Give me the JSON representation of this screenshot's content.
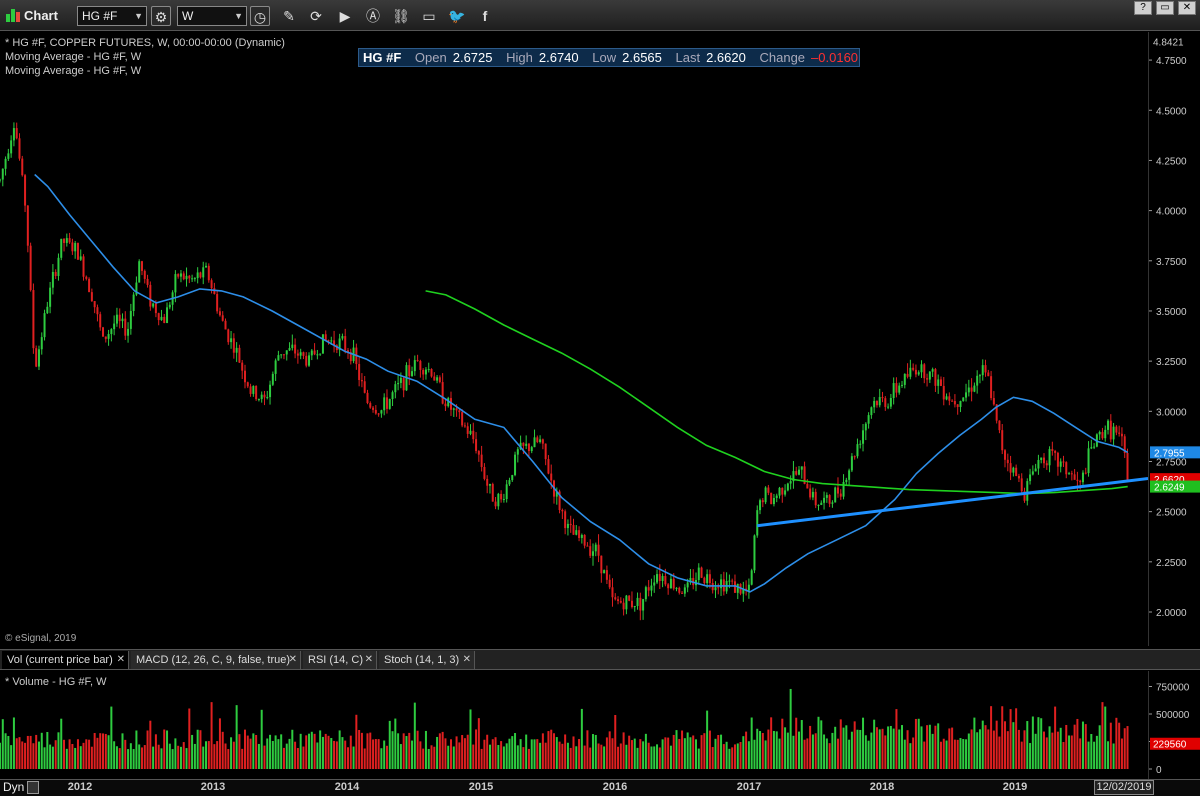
{
  "toolbar": {
    "app_title": "Chart",
    "symbol": "HG #F",
    "interval": "W",
    "help_label": "?"
  },
  "chart_header": {
    "line1": "* HG #F, COPPER FUTURES, W, 00:00-00:00 (Dynamic)",
    "line2": "Moving Average - HG #F, W",
    "line3": "Moving Average - HG #F, W"
  },
  "quote": {
    "symbol": "HG #F",
    "open_label": "Open",
    "open": "2.6725",
    "high_label": "High",
    "high": "2.6740",
    "low_label": "Low",
    "low": "2.6565",
    "last_label": "Last",
    "last": "2.6620",
    "change_label": "Change",
    "change": "–0.0160"
  },
  "copyright": "© eSignal, 2019",
  "tabs": [
    {
      "label": "Vol (current price bar)"
    },
    {
      "label": "MACD (12, 26, C, 9, false, true)"
    },
    {
      "label": "RSI (14, C)"
    },
    {
      "label": "Stoch (14, 1, 3)"
    }
  ],
  "volume_panel": {
    "title": "* Volume - HG #F, W",
    "ticks": [
      "750000",
      "500000",
      "250000",
      "0"
    ],
    "last_volume": "229560"
  },
  "time_axis": {
    "mode": "Dyn",
    "date": "12/02/2019",
    "years": [
      "2012",
      "2013",
      "2014",
      "2015",
      "2016",
      "2017",
      "2018",
      "2019"
    ]
  },
  "chart_data": {
    "type": "line",
    "title": "",
    "xlabel": "",
    "ylabel": "",
    "x_range": [
      2011.62,
      2019.55
    ],
    "ylim": [
      1.91,
      4.86
    ],
    "y_ticks": [
      "4.7500",
      "4.5000",
      "4.2500",
      "4.0000",
      "3.7500",
      "3.5000",
      "3.2500",
      "3.0000",
      "2.7500",
      "2.5000",
      "2.2500",
      "2.0000"
    ],
    "y_top_label": "4.8421",
    "price_labels": [
      {
        "text": "2.7955",
        "value": 2.7955,
        "color": "#1e88e5"
      },
      {
        "text": "2.6620",
        "value": 2.662,
        "color": "#e00000"
      },
      {
        "text": "2.6249",
        "value": 2.6249,
        "color": "#1fbf1f"
      }
    ],
    "series": [
      {
        "name": "Moving Average - HG #F, W",
        "color": "#2d8ee8",
        "x": [
          2011.86,
          2011.95,
          2012.1,
          2012.25,
          2012.4,
          2012.55,
          2012.7,
          2012.85,
          2013.0,
          2013.15,
          2013.3,
          2013.5,
          2013.7,
          2013.85,
          2014.0,
          2014.15,
          2014.3,
          2014.5,
          2014.7,
          2014.9,
          2015.1,
          2015.3,
          2015.5,
          2015.7,
          2015.9,
          2016.1,
          2016.3,
          2016.5,
          2016.7,
          2016.8,
          2016.9,
          2017.05,
          2017.2,
          2017.4,
          2017.6,
          2017.8,
          2017.95,
          2018.1,
          2018.25,
          2018.4,
          2018.5,
          2018.62,
          2018.75,
          2018.9,
          2019.05,
          2019.2,
          2019.35,
          2019.41
        ],
        "values": [
          4.18,
          4.12,
          3.98,
          3.85,
          3.72,
          3.6,
          3.54,
          3.57,
          3.61,
          3.6,
          3.57,
          3.5,
          3.42,
          3.36,
          3.3,
          3.26,
          3.2,
          3.15,
          3.06,
          2.96,
          2.92,
          2.75,
          2.57,
          2.45,
          2.36,
          2.24,
          2.17,
          2.13,
          2.13,
          2.1,
          2.14,
          2.22,
          2.29,
          2.36,
          2.43,
          2.56,
          2.69,
          2.79,
          2.88,
          2.96,
          3.02,
          3.07,
          3.05,
          2.99,
          2.92,
          2.85,
          2.82,
          2.7955
        ]
      },
      {
        "name": "Moving Average - HG #F, W",
        "color": "#1fd11f",
        "x": [
          2014.56,
          2014.7,
          2014.9,
          2015.1,
          2015.3,
          2015.5,
          2015.7,
          2015.9,
          2016.1,
          2016.3,
          2016.5,
          2016.7,
          2016.9,
          2017.1,
          2017.3,
          2017.5,
          2017.7,
          2017.9,
          2018.1,
          2018.3,
          2018.5,
          2018.7,
          2018.9,
          2019.1,
          2019.3,
          2019.41
        ],
        "values": [
          3.6,
          3.58,
          3.51,
          3.43,
          3.36,
          3.29,
          3.21,
          3.12,
          3.02,
          2.92,
          2.83,
          2.77,
          2.7,
          2.66,
          2.64,
          2.63,
          2.62,
          2.61,
          2.605,
          2.6,
          2.595,
          2.59,
          2.595,
          2.605,
          2.615,
          2.6249
        ]
      }
    ],
    "trendline": {
      "color": "#1e90ff",
      "x": [
        2016.85,
        2019.55
      ],
      "values": [
        2.43,
        2.665
      ]
    },
    "candles": {
      "up_color": "#2ecc40",
      "down_color": "#e02020",
      "anchors_x": [
        2011.62,
        2011.72,
        2011.8,
        2011.86,
        2011.95,
        2012.05,
        2012.15,
        2012.25,
        2012.33,
        2012.42,
        2012.5,
        2012.58,
        2012.66,
        2012.75,
        2012.85,
        2012.95,
        2013.05,
        2013.15,
        2013.25,
        2013.35,
        2013.45,
        2013.55,
        2013.65,
        2013.75,
        2013.85,
        2013.95,
        2014.05,
        2014.15,
        2014.25,
        2014.4,
        2014.5,
        2014.6,
        2014.7,
        2014.8,
        2014.9,
        2015.0,
        2015.08,
        2015.2,
        2015.35,
        2015.45,
        2015.55,
        2015.65,
        2015.75,
        2015.85,
        2015.95,
        2016.05,
        2016.15,
        2016.25,
        2016.35,
        2016.45,
        2016.55,
        2016.65,
        2016.75,
        2016.8,
        2016.85,
        2016.9,
        2016.95,
        2017.05,
        2017.15,
        2017.25,
        2017.35,
        2017.45,
        2017.55,
        2017.65,
        2017.75,
        2017.85,
        2017.95,
        2018.02,
        2018.1,
        2018.2,
        2018.3,
        2018.4,
        2018.45,
        2018.5,
        2018.55,
        2018.62,
        2018.7,
        2018.78,
        2018.85,
        2018.92,
        2019.0,
        2019.08,
        2019.15,
        2019.25,
        2019.32,
        2019.38,
        2019.41
      ],
      "anchors_price": [
        4.15,
        4.45,
        4.0,
        3.2,
        3.55,
        3.85,
        3.8,
        3.6,
        3.35,
        3.45,
        3.4,
        3.75,
        3.55,
        3.45,
        3.68,
        3.65,
        3.7,
        3.45,
        3.3,
        3.1,
        3.05,
        3.3,
        3.3,
        3.25,
        3.35,
        3.35,
        3.3,
        3.05,
        3.0,
        3.15,
        3.25,
        3.2,
        3.05,
        2.95,
        2.85,
        2.6,
        2.55,
        2.8,
        2.85,
        2.6,
        2.4,
        2.35,
        2.3,
        2.05,
        2.05,
        2.05,
        2.2,
        2.15,
        2.1,
        2.2,
        2.15,
        2.15,
        2.1,
        2.1,
        2.5,
        2.6,
        2.55,
        2.65,
        2.7,
        2.55,
        2.55,
        2.65,
        2.85,
        3.05,
        3.05,
        3.15,
        3.22,
        3.2,
        3.15,
        3.05,
        3.1,
        3.2,
        3.15,
        2.95,
        2.8,
        2.7,
        2.6,
        2.75,
        2.78,
        2.75,
        2.7,
        2.62,
        2.8,
        2.92,
        2.9,
        2.82,
        2.66
      ]
    },
    "volume": {
      "up_color": "#2ecc40",
      "down_color": "#e02020",
      "max": 800000
    }
  }
}
